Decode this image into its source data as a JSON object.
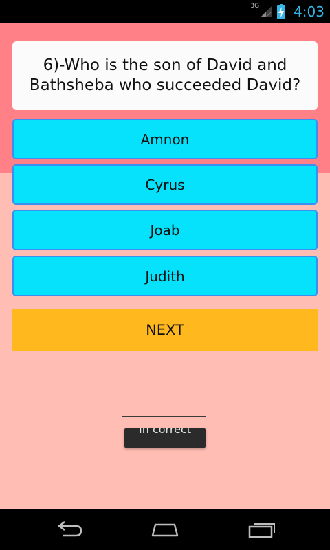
{
  "status_bar": {
    "network_label": "3G",
    "time": "4:03",
    "icons": [
      "signal-icon",
      "battery-charging-icon"
    ]
  },
  "quiz": {
    "question": "6)-Who is the son of David and Bathsheba who succeeded David?",
    "options": [
      "Amnon",
      "Cyrus",
      "Joab",
      "Judith"
    ],
    "next_label": "NEXT"
  },
  "toast": {
    "message": "In correct"
  },
  "nav_bar": {
    "icons": [
      "back-icon",
      "home-icon",
      "recents-icon"
    ]
  },
  "colors": {
    "top_band": "#ff8087",
    "background": "#ffbdb3",
    "option_fill": "#06e2fb",
    "option_border": "#3a8ff2",
    "next_button": "#ffb81e",
    "clock": "#33b5e5"
  }
}
